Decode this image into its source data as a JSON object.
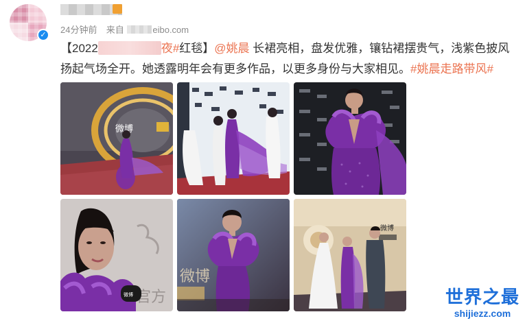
{
  "post": {
    "time": "24分钟前",
    "source_prefix": "来自",
    "source_suffix": "eibo.com",
    "text": {
      "open_bracket": "【2022",
      "hashtag_tail": "夜#",
      "title_end": "红毯】",
      "mention": "@姚晨",
      "body": " 长裙亮相，盘发优雅，镶钻裙摆贵气，浅紫色披风扬起气场全开。她透露明年会有更多作品，以更多身份与大家相见。",
      "hashtag": "#姚晨走路带风#"
    },
    "verified_mark": "✓"
  },
  "photos": [
    {
      "name": "photo-1",
      "scene": "red-carpet-wide"
    },
    {
      "name": "photo-2",
      "scene": "red-carpet-walk"
    },
    {
      "name": "photo-3",
      "scene": "portrait-backdrop"
    },
    {
      "name": "photo-4",
      "scene": "closeup-interview"
    },
    {
      "name": "photo-5",
      "scene": "backdrop-portrait"
    },
    {
      "name": "photo-6",
      "scene": "stage-interview"
    }
  ],
  "watermark": {
    "cn": "世界之最",
    "en": "shijiezz.com"
  },
  "colors": {
    "link": "#eb7350",
    "meta": "#8b8b8b",
    "verified": "#1a8cf0",
    "watermark": "#1e6fd9",
    "dress": "#7a2fa6"
  }
}
